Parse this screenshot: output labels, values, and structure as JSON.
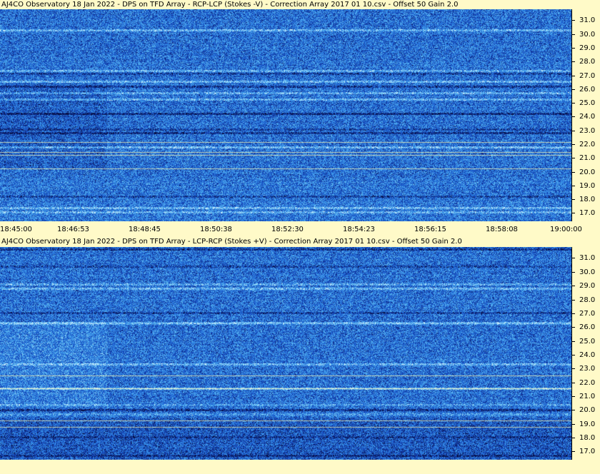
{
  "panels": [
    {
      "title": "AJ4CO Observatory 18 Jan 2022  -  DPS on TFD Array  -  RCP-LCP (Stokes -V)  -  Correction Array 2017 01 10.csv  -  Offset 50  Gain 2.0",
      "polarity": "dark-bias",
      "seed": 17
    },
    {
      "title": "AJ4CO Observatory 18 Jan 2022  -  DPS on TFD Array  -  LCP-RCP (Stokes +V)  -  Correction Array 2017 01 10.csv  -  Offset 50  Gain 2.0",
      "polarity": "light-bias",
      "seed": 43
    }
  ],
  "y_axis": {
    "ticks": [
      "31.0",
      "30.0",
      "29.0",
      "28.0",
      "27.0",
      "26.0",
      "25.0",
      "24.0",
      "23.0",
      "22.0",
      "21.0",
      "20.0",
      "19.0",
      "18.0",
      "17.0"
    ],
    "min": 16.4,
    "max": 31.8
  },
  "x_axis": {
    "ticks": [
      "18:45:00",
      "18:46:53",
      "18:48:45",
      "18:50:38",
      "18:52:30",
      "18:54:23",
      "18:56:15",
      "18:58:08",
      "19:00:00"
    ]
  },
  "colors": {
    "background": "#fffac8",
    "spectrogram_base": "#1f5bcf"
  }
}
